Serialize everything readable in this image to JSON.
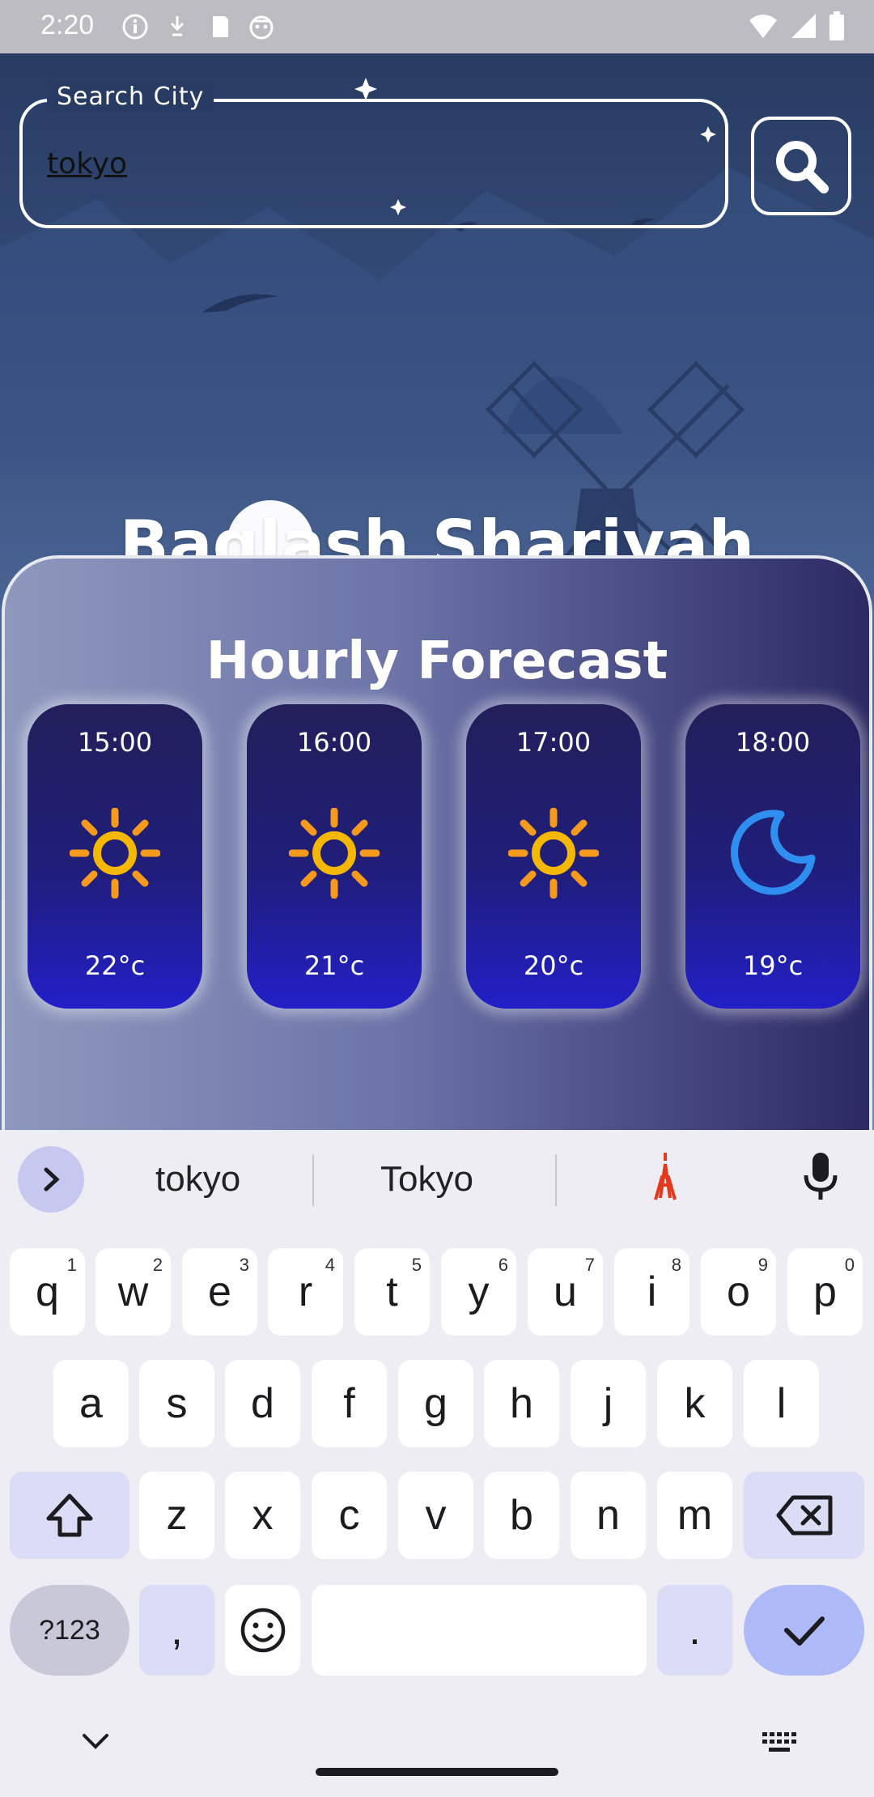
{
  "status_bar": {
    "time": "2:20"
  },
  "search": {
    "label": "Search City",
    "value": "tokyo"
  },
  "city_name": "Baqlash Shariyah",
  "forecast": {
    "title": "Hourly Forecast",
    "hours": [
      {
        "time": "15:00",
        "icon": "sun-icon",
        "temp": "22°c"
      },
      {
        "time": "16:00",
        "icon": "sun-icon",
        "temp": "21°c"
      },
      {
        "time": "17:00",
        "icon": "sun-icon",
        "temp": "20°c"
      },
      {
        "time": "18:00",
        "icon": "moon-icon",
        "temp": "19°c"
      }
    ]
  },
  "keyboard": {
    "suggestions": [
      "tokyo",
      "Tokyo"
    ],
    "row1": [
      {
        "k": "q",
        "n": "1"
      },
      {
        "k": "w",
        "n": "2"
      },
      {
        "k": "e",
        "n": "3"
      },
      {
        "k": "r",
        "n": "4"
      },
      {
        "k": "t",
        "n": "5"
      },
      {
        "k": "y",
        "n": "6"
      },
      {
        "k": "u",
        "n": "7"
      },
      {
        "k": "i",
        "n": "8"
      },
      {
        "k": "o",
        "n": "9"
      },
      {
        "k": "p",
        "n": "0"
      }
    ],
    "row2": [
      "a",
      "s",
      "d",
      "f",
      "g",
      "h",
      "j",
      "k",
      "l"
    ],
    "row3": [
      "z",
      "x",
      "c",
      "v",
      "b",
      "n",
      "m"
    ],
    "sym_label": "?123",
    "comma": ",",
    "period": "."
  },
  "colors": {
    "sun": "#f5b800",
    "sun_rays": "#f59a1c",
    "moon": "#2f8ff0",
    "enter_key": "#aeb9f7"
  }
}
